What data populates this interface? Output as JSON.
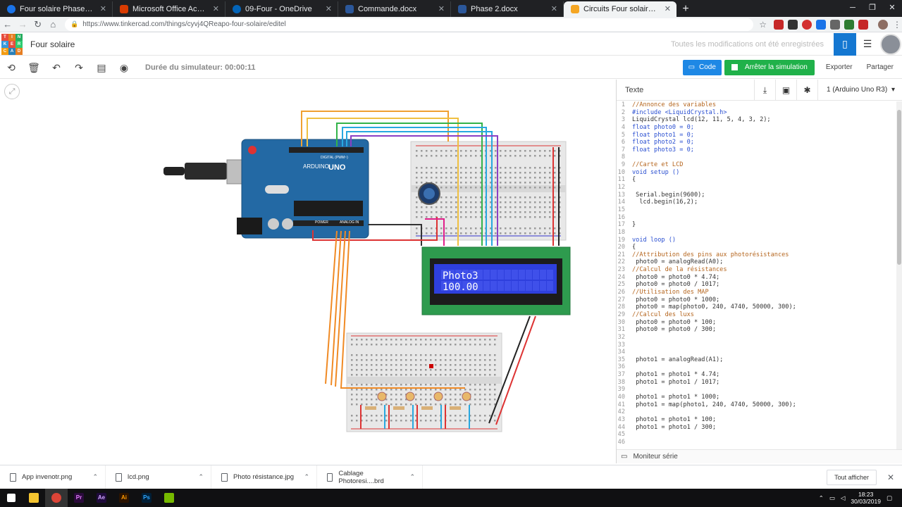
{
  "browser": {
    "tabs": [
      {
        "label": "Four solaire Phase 2 on Prezi Ne",
        "color": "#1a73e8"
      },
      {
        "label": "Microsoft Office Accueil",
        "color": "#d83b01"
      },
      {
        "label": "09-Four - OneDrive",
        "color": "#0364b8"
      },
      {
        "label": "Commande.docx",
        "color": "#2b579a"
      },
      {
        "label": "Phase 2.docx",
        "color": "#2b579a"
      },
      {
        "label": "Circuits Four solaire | Tinkercad",
        "color": "#f5a623"
      }
    ],
    "new_tab": "+",
    "url": "https://www.tinkercad.com/things/cyvj4QReapo-four-solaire/editel"
  },
  "header": {
    "logo_letters": [
      "TIN",
      "KER",
      "CAD"
    ],
    "project_name": "Four solaire",
    "saved_status": "Toutes les modifications ont été enregistrées"
  },
  "toolbar": {
    "sim_time": "Durée du simulateur: 00:00:11",
    "code_label": "Code",
    "stop_label": "Arrêter la simulation",
    "export_label": "Exporter",
    "share_label": "Partager"
  },
  "circuit": {
    "arduino_label": "UNO",
    "arduino_brand": "ARDUINO",
    "digital_label": "DIGITAL (PWM~)",
    "power_label": "POWER",
    "analog_label": "ANALOG IN",
    "lcd_line1": "Photo3",
    "lcd_line2": "100.00"
  },
  "codepanel": {
    "mode": "Texte",
    "device": "1 (Arduino Uno R3)",
    "serial_monitor": "Moniteur série",
    "lines": [
      "//Annonce des variables",
      "#include <LiquidCrystal.h>",
      "LiquidCrystal lcd(12, 11, 5, 4, 3, 2);",
      "float photo0 = 0;",
      "float photo1 = 0;",
      "float photo2 = 0;",
      "float photo3 = 0;",
      "",
      "//Carte et LCD",
      "void setup ()",
      "{",
      "",
      " Serial.begin(9600);",
      "  lcd.begin(16,2);",
      "",
      "",
      "}",
      "",
      "void loop ()",
      "{",
      "//Attribution des pins aux photorésistances",
      " photo0 = analogRead(A0);",
      "//Calcul de la résistances",
      " photo0 = photo0 * 4.74;",
      " photo0 = photo0 / 1017;",
      "//Utilisation des MAP",
      " photo0 = photo0 * 1000;",
      " photo0 = map(photo0, 240, 4740, 50000, 300);",
      "//Calcul des luxs",
      " photo0 = photo0 * 100;",
      " photo0 = photo0 / 300;",
      "",
      "",
      "",
      " photo1 = analogRead(A1);",
      "",
      " photo1 = photo1 * 4.74;",
      " photo1 = photo1 / 1017;",
      "",
      " photo1 = photo1 * 1000;",
      " photo1 = map(photo1, 240, 4740, 50000, 300);",
      "",
      " photo1 = photo1 * 100;",
      " photo1 = photo1 / 300;",
      "",
      ""
    ]
  },
  "downloads": {
    "items": [
      "App invenotr.png",
      "lcd.png",
      "Photo résistance.jpg",
      "Cablage Photoresi....brd"
    ],
    "show_all": "Tout afficher"
  },
  "taskbar": {
    "time": "18:23",
    "date": "30/03/2019",
    "apps": [
      {
        "name": "Pr",
        "color": "#2a0a3b",
        "fg": "#e77cff"
      },
      {
        "name": "Ae",
        "color": "#1f0a3b",
        "fg": "#d0a4ff"
      },
      {
        "name": "Ai",
        "color": "#2b1300",
        "fg": "#ff9a00"
      },
      {
        "name": "Ps",
        "color": "#001e36",
        "fg": "#31a8ff"
      }
    ]
  },
  "colors": {
    "tinkercad_blue": "#1477d1",
    "sim_green": "#20b14a",
    "arduino_teal": "#2369a4",
    "lcd_blue": "#2e3fdd"
  }
}
